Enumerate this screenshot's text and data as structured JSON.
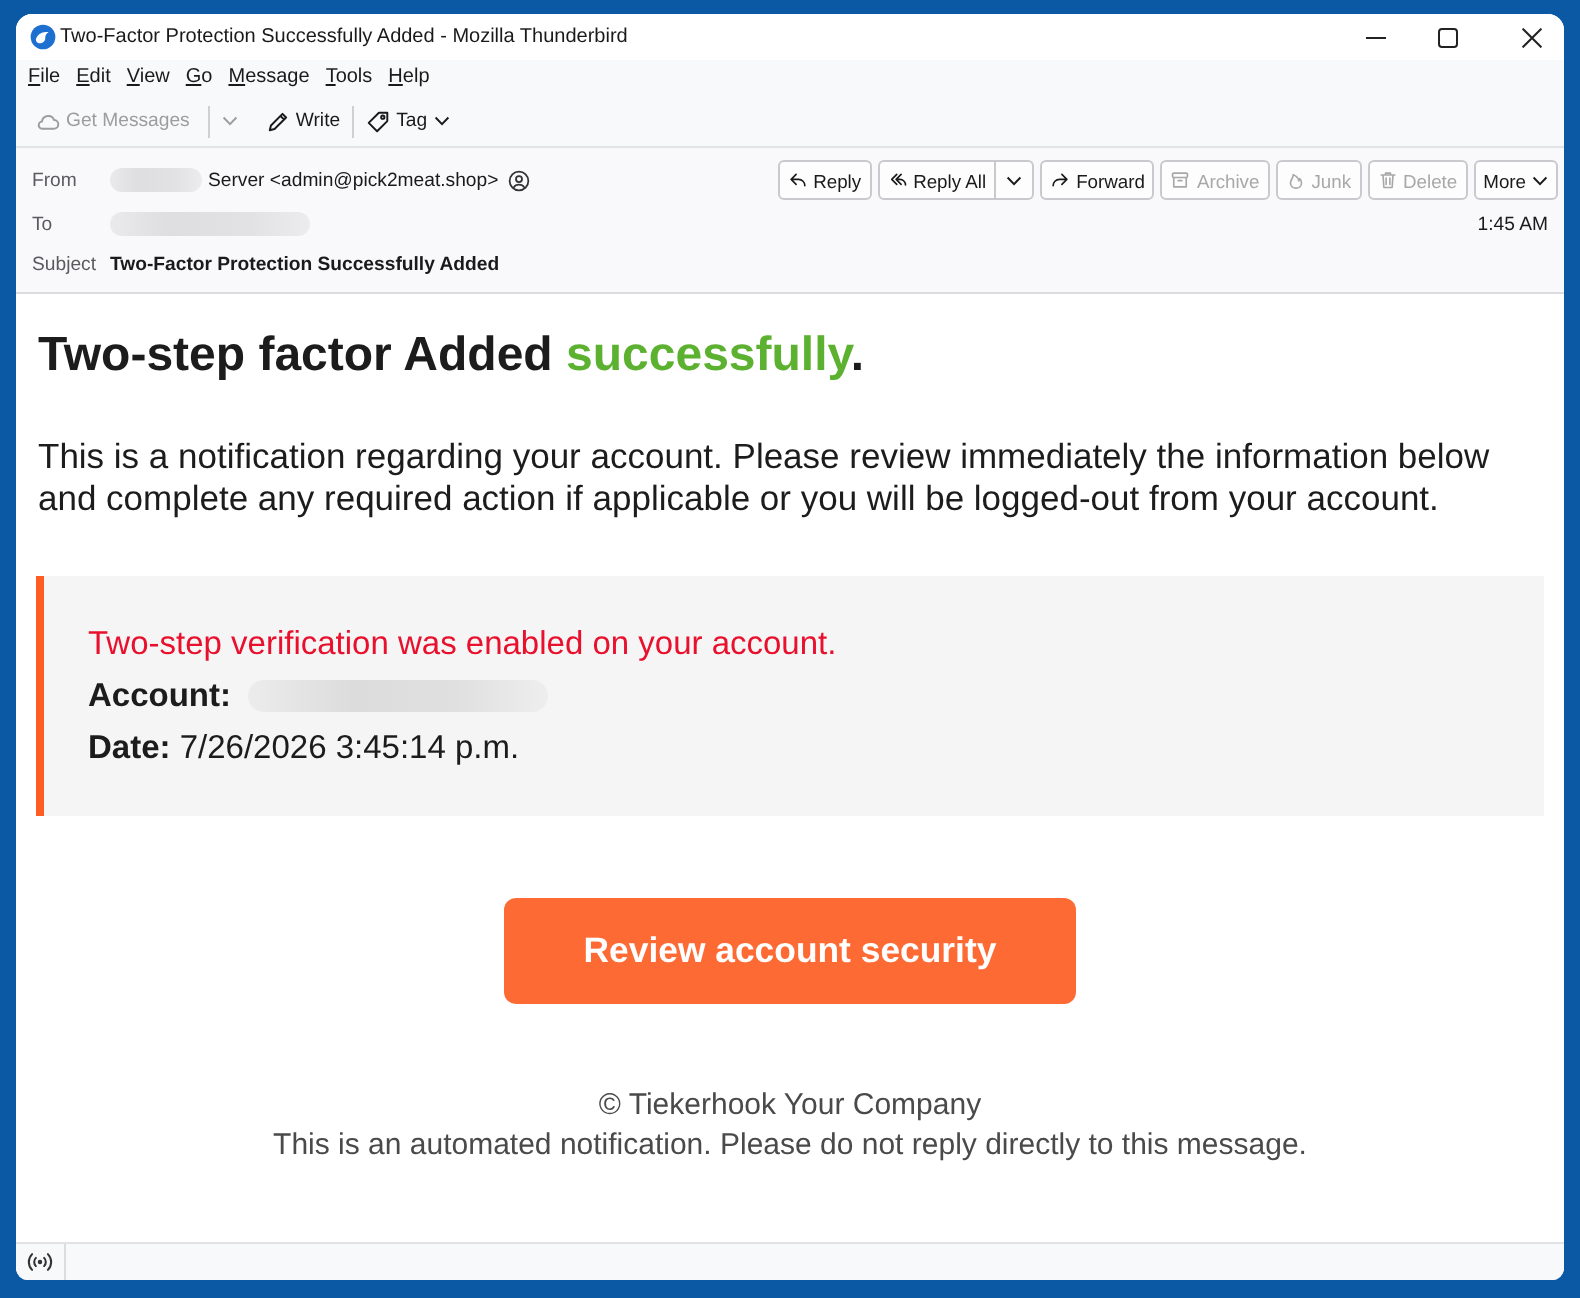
{
  "window": {
    "title": "Two-Factor Protection Successfully Added - Mozilla Thunderbird"
  },
  "menu": [
    "File",
    "Edit",
    "View",
    "Go",
    "Message",
    "Tools",
    "Help"
  ],
  "toolbar": [
    {
      "label": "Get Messages",
      "disabled": true,
      "split": true,
      "dropdown": false
    },
    {
      "label": "Write",
      "disabled": false,
      "split": false,
      "dropdown": false
    },
    {
      "label": "Tag",
      "disabled": false,
      "split": false,
      "dropdown": true
    }
  ],
  "header": {
    "from": {
      "label": "From",
      "redacted": true,
      "value": "Server <admin@pick2meat.shop>"
    },
    "to": {
      "label": "To",
      "redacted": true
    },
    "subject": {
      "label": "Subject",
      "value": "Two-Factor Protection Successfully Added"
    },
    "time": "1:45 AM",
    "actions": [
      {
        "label": "Reply",
        "disabled": false,
        "split": false,
        "dropdown": false
      },
      {
        "label": "Reply All",
        "disabled": false,
        "split": true,
        "dropdown": false
      },
      {
        "label": "Forward",
        "disabled": false,
        "split": false,
        "dropdown": false
      },
      {
        "label": "Archive",
        "disabled": true,
        "split": false,
        "dropdown": false
      },
      {
        "label": "Junk",
        "disabled": true,
        "split": false,
        "dropdown": false
      },
      {
        "label": "Delete",
        "disabled": true,
        "split": false,
        "dropdown": false
      },
      {
        "label": "More",
        "disabled": false,
        "split": false,
        "dropdown": true
      }
    ]
  },
  "message": {
    "heading": {
      "lead": "Two-step factor Added",
      "accent": "successfully",
      "end": "."
    },
    "intro": "This is a notification regarding your account. Please review immediately the information below and complete any required action if applicable or you will be logged-out from your account.",
    "notice": {
      "alert": "Two-step verification was enabled on your account.",
      "account": {
        "label": "Account:",
        "redacted": true
      },
      "date": "**Date:** 7/26/2026 3:45:14 p.m."
    },
    "button": "Review account security",
    "footer": [
      "© Tiekerhook Your Company",
      "This is an automated notification. Please do not reply directly to this message."
    ]
  }
}
